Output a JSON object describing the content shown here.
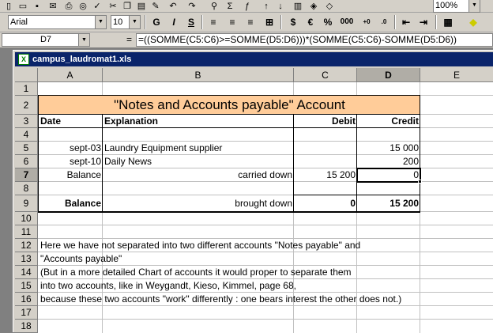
{
  "zoom": "100%",
  "font": {
    "name": "Arial",
    "size": "10"
  },
  "toolbar_format": {
    "bold": "G",
    "italic": "I",
    "underline": "S",
    "currency": "€",
    "percent": "%",
    "thousands": "000",
    "inc_dec": "+,0\n,00",
    "dec_dec": ",00\n+,0"
  },
  "formula_bar": {
    "cell_ref": "D7",
    "equals": "=",
    "formula": "=((SOMME(C5:C6)>=SOMME(D5:D6)))*(SOMME(C5:C6)-SOMME(D5:D6))"
  },
  "window": {
    "title": "campus_laudromat1.xls",
    "icon_text": "X"
  },
  "columns": [
    "A",
    "B",
    "C",
    "D",
    "E"
  ],
  "rows": [
    "1",
    "2",
    "3",
    "4",
    "5",
    "6",
    "7",
    "8",
    "9",
    "10",
    "11",
    "12",
    "13",
    "14",
    "15",
    "16",
    "17",
    "18"
  ],
  "sheet": {
    "title": "\"Notes and Accounts payable\" Account",
    "headers": {
      "date": "Date",
      "explanation": "Explanation",
      "debit": "Debit",
      "credit": "Credit"
    },
    "r5": {
      "date": "sept-03",
      "explanation": "Laundry Equipment supplier",
      "credit": "15 000"
    },
    "r6": {
      "date": "sept-10",
      "explanation": "Daily News",
      "credit": "200"
    },
    "r7": {
      "date": "Balance",
      "explanation": "carried down",
      "debit": "15 200",
      "credit": "0"
    },
    "r9": {
      "date": "Balance",
      "explanation": "brought down",
      "debit": "0",
      "credit": "15 200"
    },
    "notes": [
      "Here we have not separated into two different accounts \"Notes payable\" and",
      "\"Accounts payable\"",
      "(But in a more detailed Chart of accounts it would proper to separate them",
      "into two accounts, like in Weygandt, Kieso, Kimmel, page 68,",
      "because these two accounts \"work\" differently : one bears interest the other does not.)"
    ]
  },
  "colors": {
    "title_fill": "#ffcc99",
    "titlebar": "#0a246a"
  }
}
